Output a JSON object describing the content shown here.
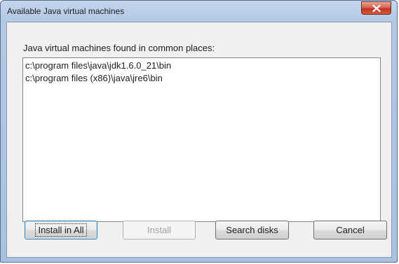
{
  "window": {
    "title": "Available Java virtual machines"
  },
  "dialog": {
    "heading": "Java virtual machines found in common places:",
    "jvm_list": [
      "c:\\program files\\java\\jdk1.6.0_21\\bin",
      "c:\\program files (x86)\\java\\jre6\\bin"
    ]
  },
  "buttons": {
    "install_all": "Install in All",
    "install": "Install",
    "search_disks": "Search disks",
    "cancel": "Cancel"
  },
  "colors": {
    "close_button": "#c7432b",
    "title_bar": "#b9cde8",
    "dialog_background": "#f0f0f0"
  }
}
